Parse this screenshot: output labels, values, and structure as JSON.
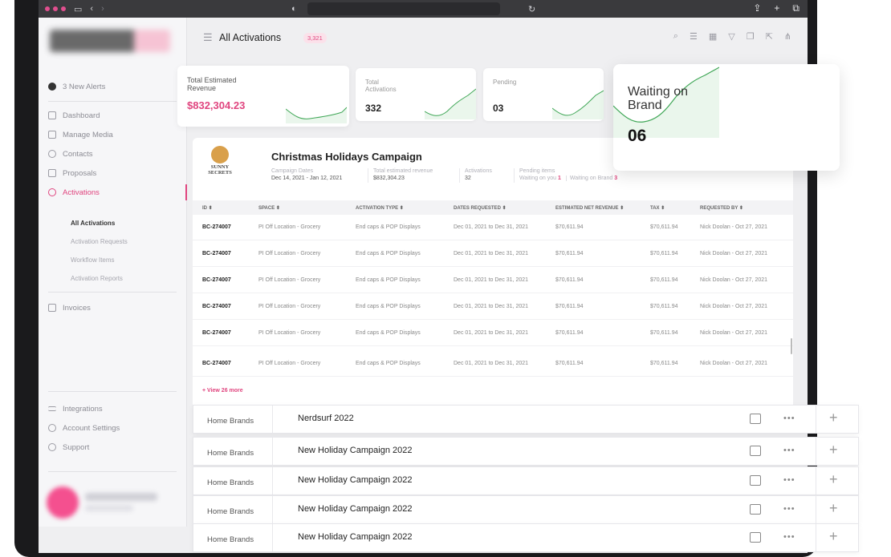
{
  "header": {
    "title": "All Activations",
    "count_badge": "3,321"
  },
  "sidebar": {
    "alerts": "3 New Alerts",
    "items": [
      {
        "label": "Dashboard"
      },
      {
        "label": "Manage Media"
      },
      {
        "label": "Contacts"
      },
      {
        "label": "Proposals"
      },
      {
        "label": "Activations"
      }
    ],
    "sub_items": [
      {
        "label": "All Activations"
      },
      {
        "label": "Activation Requests"
      },
      {
        "label": "Workflow Items"
      },
      {
        "label": "Activation Reports"
      }
    ],
    "invoices": "Invoices",
    "bottom_items": [
      {
        "label": "Integrations"
      },
      {
        "label": "Account Settings"
      },
      {
        "label": "Support"
      }
    ]
  },
  "stats": {
    "revenue": {
      "label": "Total Estimated Revenue",
      "value": "$832,304.23"
    },
    "total": {
      "label": "Total Activations",
      "value": "332"
    },
    "pending": {
      "label": "Pending",
      "value": "03"
    },
    "waiting": {
      "label": "Waiting on Brand",
      "value": "06"
    }
  },
  "campaign": {
    "logo_text": "SUNNY SECRETS",
    "title": "Christmas Holidays Campaign",
    "dates_label": "Campaign Dates",
    "dates_value": "Dec 14, 2021 - Jan 12, 2021",
    "revenue_label": "Total estimated revenue",
    "revenue_value": "$832,304.23",
    "activations_label": "Activations",
    "activations_value": "32",
    "pending_label": "Pending items",
    "waiting_on_you_label": "Waiting on you",
    "waiting_on_you_value": "1",
    "waiting_on_brand_label": "Waiting on Brand",
    "waiting_on_brand_value": "3",
    "columns": [
      "ID ⬍",
      "SPACE ⬍",
      "ACTIVATION TYPE ⬍",
      "DATES REQUESTED ⬍",
      "ESTIMATED NET REVENUE ⬍",
      "TAX ⬍",
      "REQUESTED BY ⬍"
    ],
    "rows": [
      [
        "BC-274007",
        "PI Off Location - Grocery",
        "End caps & POP Displays",
        "Dec 01, 2021 to Dec 31, 2021",
        "$70,611.94",
        "$70,611.94",
        "Nick Doolan - Oct 27, 2021"
      ],
      [
        "BC-274007",
        "PI Off Location - Grocery",
        "End caps & POP Displays",
        "Dec 01, 2021 to Dec 31, 2021",
        "$70,611.94",
        "$70,611.94",
        "Nick Doolan - Oct 27, 2021"
      ],
      [
        "BC-274007",
        "PI Off Location - Grocery",
        "End caps & POP Displays",
        "Dec 01, 2021 to Dec 31, 2021",
        "$70,611.94",
        "$70,611.94",
        "Nick Doolan - Oct 27, 2021"
      ],
      [
        "BC-274007",
        "PI Off Location - Grocery",
        "End caps & POP Displays",
        "Dec 01, 2021 to Dec 31, 2021",
        "$70,611.94",
        "$70,611.94",
        "Nick Doolan - Oct 27, 2021"
      ],
      [
        "BC-274007",
        "PI Off Location - Grocery",
        "End caps & POP Displays",
        "Dec 01, 2021 to Dec 31, 2021",
        "$70,611.94",
        "$70,611.94",
        "Nick Doolan - Oct 27, 2021"
      ],
      [
        "BC-274007",
        "PI Off Location - Grocery",
        "End caps & POP Displays",
        "Dec 01, 2021 to Dec 31, 2021",
        "$70,611.94",
        "$70,611.94",
        "Nick Doolan - Oct 27, 2021"
      ]
    ],
    "view_more": "+ View 26 more"
  },
  "campaign_list": [
    {
      "brand": "Home Brands",
      "name": "Nerdsurf 2022"
    },
    {
      "brand": "Home Brands",
      "name": "New Holiday Campaign 2022"
    },
    {
      "brand": "Home Brands",
      "name": "New Holiday Campaign 2022"
    },
    {
      "brand": "Home Brands",
      "name": "New Holiday Campaign 2022"
    },
    {
      "brand": "Home Brands",
      "name": "New Holiday Campaign 2022"
    }
  ],
  "colors": {
    "accent": "#e0457f",
    "chart_line": "#3ea655"
  }
}
